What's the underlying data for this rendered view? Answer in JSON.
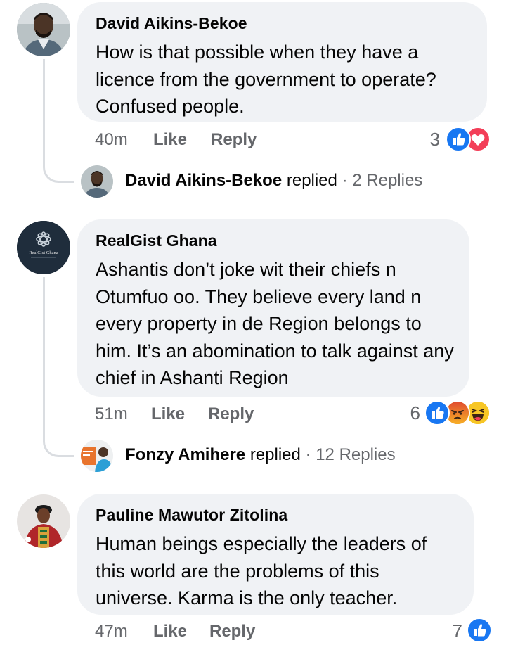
{
  "comments": [
    {
      "author": "David Aikins-Bekoe",
      "text": "How is that possible when they have a licence from the government to operate? Confused people.",
      "time": "40m",
      "like": "Like",
      "reply": "Reply",
      "reaction_count": "3",
      "reactions": [
        "like-icon",
        "love-icon"
      ],
      "replied": {
        "name": "David Aikins-Bekoe",
        "verb": "replied",
        "dot": "·",
        "count": "2 Replies"
      }
    },
    {
      "author": "RealGist Ghana",
      "text": "Ashantis don’t joke wit their chiefs n Otumfuo oo. They believe every land n every property in de Region belongs to him. It’s an abomination to talk against any chief in Ashanti Region",
      "time": "51m",
      "like": "Like",
      "reply": "Reply",
      "reaction_count": "6",
      "reactions": [
        "like-icon",
        "angry-icon",
        "haha-icon"
      ],
      "avatar_text": "RealGist Ghana",
      "replied": {
        "name": "Fonzy Amihere",
        "verb": "replied",
        "dot": "·",
        "count": "12 Replies"
      }
    },
    {
      "author": "Pauline Mawutor Zitolina",
      "text": "Human beings especially the leaders of this world are the problems of this universe. Karma is the only teacher.",
      "time": "47m",
      "like": "Like",
      "reply": "Reply",
      "reaction_count": "7",
      "reactions": [
        "like-icon"
      ]
    }
  ],
  "colors": {
    "bubble": "#f0f2f5",
    "meta": "#65676b",
    "like_blue": "#1877f2",
    "love_red": "#f33e58",
    "angry_orange": "#e9710f",
    "haha_yellow": "#f7b125"
  }
}
